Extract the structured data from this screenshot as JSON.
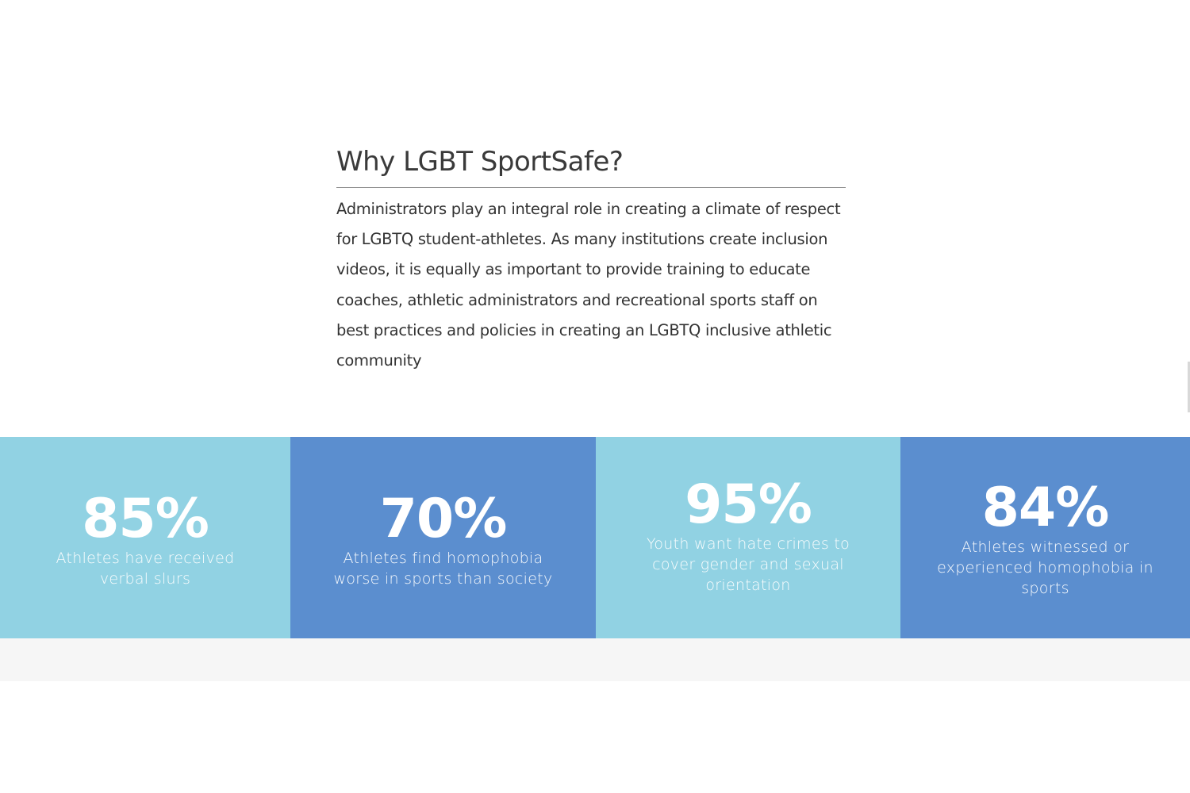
{
  "intro": {
    "title": "Why LGBT SportSafe?",
    "body": "Administrators play an integral role in creating a climate of respect for LGBTQ student-athletes. As many institutions create inclusion videos, it is equally as important to provide training to educate coaches, athletic administrators and recreational sports staff on best practices and policies in creating an LGBTQ inclusive athletic community"
  },
  "stats": [
    {
      "value": "85%",
      "label": "Athletes have received verbal slurs",
      "color": "#91d2e3"
    },
    {
      "value": "70%",
      "label": "Athletes find homophobia worse in sports than society",
      "color": "#5b8ecf"
    },
    {
      "value": "95%",
      "label": "Youth want hate crimes to cover gender and sexual orientation",
      "color": "#91d2e3"
    },
    {
      "value": "84%",
      "label": "Athletes witnessed or experienced homophobia in sports",
      "color": "#5b8ecf"
    }
  ]
}
